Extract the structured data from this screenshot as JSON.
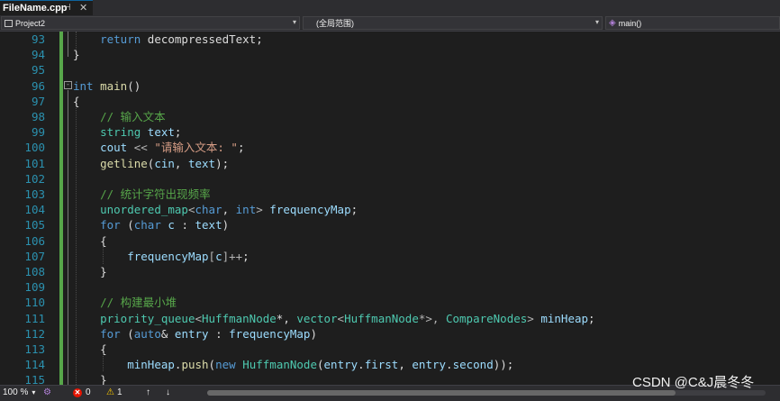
{
  "tab": {
    "title": "FileName.cpp",
    "pin": "⊣",
    "close": "✕"
  },
  "nav": {
    "project": "Project2",
    "scope": "(全局范围)",
    "member": "main()"
  },
  "lines": [
    {
      "n": "93",
      "tokens": [
        [
          "    ",
          "t"
        ],
        [
          "return",
          "kw"
        ],
        [
          " decompressedText;",
          "t"
        ]
      ]
    },
    {
      "n": "94",
      "tokens": [
        [
          "}",
          "t"
        ]
      ]
    },
    {
      "n": "95",
      "tokens": []
    },
    {
      "n": "96",
      "tokens": [
        [
          "int",
          "kw"
        ],
        [
          " ",
          "t"
        ],
        [
          "main",
          "fn"
        ],
        [
          "()",
          "t"
        ]
      ]
    },
    {
      "n": "97",
      "tokens": [
        [
          "{",
          "t"
        ]
      ]
    },
    {
      "n": "98",
      "tokens": [
        [
          "    ",
          "t"
        ],
        [
          "// 输入文本",
          "cm"
        ]
      ]
    },
    {
      "n": "99",
      "tokens": [
        [
          "    ",
          "t"
        ],
        [
          "string",
          "ty"
        ],
        [
          " ",
          "t"
        ],
        [
          "text",
          "var"
        ],
        [
          ";",
          "t"
        ]
      ]
    },
    {
      "n": "100",
      "tokens": [
        [
          "    ",
          "t"
        ],
        [
          "cout",
          "var"
        ],
        [
          " << ",
          "op"
        ],
        [
          "\"请输入文本: \"",
          "str"
        ],
        [
          ";",
          "t"
        ]
      ]
    },
    {
      "n": "101",
      "tokens": [
        [
          "    ",
          "t"
        ],
        [
          "getline",
          "fn"
        ],
        [
          "(",
          "t"
        ],
        [
          "cin",
          "var"
        ],
        [
          ", ",
          "t"
        ],
        [
          "text",
          "var"
        ],
        [
          ");",
          "t"
        ]
      ]
    },
    {
      "n": "102",
      "tokens": []
    },
    {
      "n": "103",
      "tokens": [
        [
          "    ",
          "t"
        ],
        [
          "// 统计字符出现频率",
          "cm"
        ]
      ]
    },
    {
      "n": "104",
      "tokens": [
        [
          "    ",
          "t"
        ],
        [
          "unordered_map",
          "ty"
        ],
        [
          "<",
          "op"
        ],
        [
          "char",
          "kw"
        ],
        [
          ", ",
          "t"
        ],
        [
          "int",
          "kw"
        ],
        [
          "> ",
          "op"
        ],
        [
          "frequencyMap",
          "var"
        ],
        [
          ";",
          "t"
        ]
      ]
    },
    {
      "n": "105",
      "tokens": [
        [
          "    ",
          "t"
        ],
        [
          "for",
          "kw"
        ],
        [
          " (",
          "t"
        ],
        [
          "char",
          "kw"
        ],
        [
          " ",
          "t"
        ],
        [
          "c",
          "var"
        ],
        [
          " : ",
          "t"
        ],
        [
          "text",
          "var"
        ],
        [
          ")",
          "t"
        ]
      ]
    },
    {
      "n": "106",
      "tokens": [
        [
          "    {",
          "t"
        ]
      ]
    },
    {
      "n": "107",
      "tokens": [
        [
          "        ",
          "t"
        ],
        [
          "frequencyMap",
          "var"
        ],
        [
          "[",
          "op"
        ],
        [
          "c",
          "var"
        ],
        [
          "]++",
          "op"
        ],
        [
          ";",
          "t"
        ]
      ]
    },
    {
      "n": "108",
      "tokens": [
        [
          "    }",
          "t"
        ]
      ]
    },
    {
      "n": "109",
      "tokens": []
    },
    {
      "n": "110",
      "tokens": [
        [
          "    ",
          "t"
        ],
        [
          "// 构建最小堆",
          "cm"
        ]
      ]
    },
    {
      "n": "111",
      "tokens": [
        [
          "    ",
          "t"
        ],
        [
          "priority_queue",
          "ty"
        ],
        [
          "<",
          "op"
        ],
        [
          "HuffmanNode",
          "ty"
        ],
        [
          "*, ",
          "t"
        ],
        [
          "vector",
          "ty"
        ],
        [
          "<",
          "op"
        ],
        [
          "HuffmanNode",
          "ty"
        ],
        [
          "*>, ",
          "op"
        ],
        [
          "CompareNodes",
          "ty"
        ],
        [
          "> ",
          "op"
        ],
        [
          "minHeap",
          "var"
        ],
        [
          ";",
          "t"
        ]
      ]
    },
    {
      "n": "112",
      "tokens": [
        [
          "    ",
          "t"
        ],
        [
          "for",
          "kw"
        ],
        [
          " (",
          "t"
        ],
        [
          "auto",
          "kw"
        ],
        [
          "& ",
          "t"
        ],
        [
          "entry",
          "var"
        ],
        [
          " : ",
          "t"
        ],
        [
          "frequencyMap",
          "var"
        ],
        [
          ")",
          "t"
        ]
      ]
    },
    {
      "n": "113",
      "tokens": [
        [
          "    {",
          "t"
        ]
      ]
    },
    {
      "n": "114",
      "tokens": [
        [
          "        ",
          "t"
        ],
        [
          "minHeap",
          "var"
        ],
        [
          ".",
          "t"
        ],
        [
          "push",
          "fn"
        ],
        [
          "(",
          "t"
        ],
        [
          "new",
          "kw"
        ],
        [
          " ",
          "t"
        ],
        [
          "HuffmanNode",
          "ty"
        ],
        [
          "(",
          "t"
        ],
        [
          "entry",
          "var"
        ],
        [
          ".",
          "t"
        ],
        [
          "first",
          "var"
        ],
        [
          ", ",
          "t"
        ],
        [
          "entry",
          "var"
        ],
        [
          ".",
          "t"
        ],
        [
          "second",
          "var"
        ],
        [
          "));",
          "t"
        ]
      ]
    },
    {
      "n": "115",
      "tokens": [
        [
          "    }",
          "t"
        ]
      ]
    }
  ],
  "status": {
    "zoom": "100 %",
    "errors": "0",
    "warnings": "1",
    "up_arrow": "↑",
    "down_arrow": "↓"
  },
  "watermark": "CSDN @C&J晨冬冬"
}
